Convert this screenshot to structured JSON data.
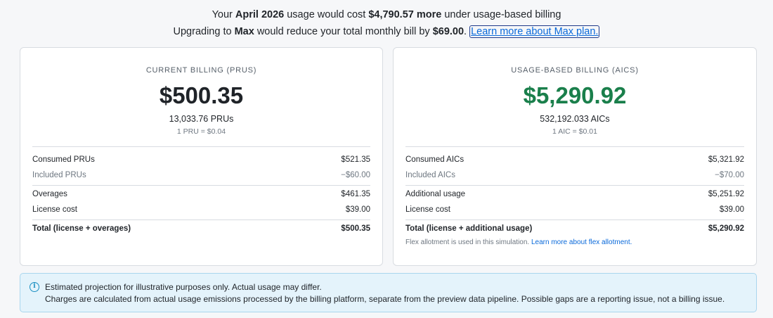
{
  "headline": {
    "line1_pre": "Your ",
    "line1_month": "April 2026",
    "line1_mid": " usage would cost ",
    "line1_amount": "$4,790.57 more",
    "line1_post": " under usage-based billing",
    "line2_pre": "Upgrading to ",
    "line2_plan": "Max",
    "line2_mid": " would reduce your total monthly bill by ",
    "line2_amount": "$69.00",
    "line2_post": ". ",
    "line2_link": "Learn more about Max plan."
  },
  "current": {
    "label": "CURRENT BILLING (PRUS)",
    "amount": "$500.35",
    "units": "13,033.76 PRUs",
    "rate": "1 PRU = $0.04",
    "rows": [
      {
        "label": "Consumed PRUs",
        "value": "$521.35"
      },
      {
        "label": "Included PRUs",
        "value": "−$60.00"
      },
      {
        "label": "Overages",
        "value": "$461.35"
      },
      {
        "label": "License cost",
        "value": "$39.00"
      },
      {
        "label": "Total (license + overages)",
        "value": "$500.35"
      }
    ]
  },
  "usage": {
    "label": "USAGE-BASED BILLING (AICS)",
    "amount": "$5,290.92",
    "amount_color": "#1a7f4b",
    "units": "532,192.033 AICs",
    "rate": "1 AIC = $0.01",
    "rows": [
      {
        "label": "Consumed AICs",
        "value": "$5,321.92"
      },
      {
        "label": "Included AICs",
        "value": "−$70.00"
      },
      {
        "label": "Additional usage",
        "value": "$5,251.92"
      },
      {
        "label": "License cost",
        "value": "$39.00"
      },
      {
        "label": "Total (license + additional usage)",
        "value": "$5,290.92"
      }
    ],
    "note_text": "Flex allotment is used in this simulation. ",
    "note_link": "Learn more about flex allotment."
  },
  "info": {
    "icon": "info-icon",
    "line1": "Estimated projection for illustrative purposes only. Actual usage may differ.",
    "line2": "Charges are calculated from actual usage emissions processed by the billing platform, separate from the preview data pipeline. Possible gaps are a reporting issue, not a billing issue."
  }
}
